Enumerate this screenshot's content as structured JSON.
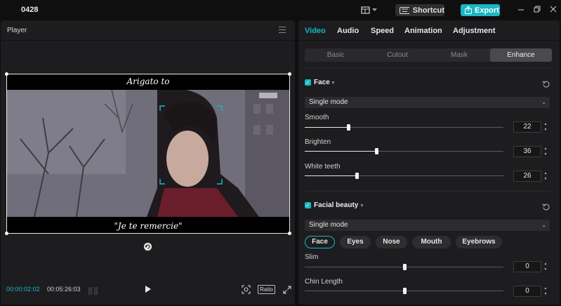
{
  "app": {
    "project_name": "0428",
    "shortcut_label": "Shortcut",
    "export_label": "Export"
  },
  "player": {
    "title": "Player",
    "subtitle_top": "Arigato to",
    "subtitle_bottom": "\"Je te remercie\"",
    "current_time": "00:00:02:02",
    "total_time": "00:05:26:03",
    "ratio_label": "Ratio"
  },
  "panel": {
    "tabs": [
      "Video",
      "Audio",
      "Speed",
      "Animation",
      "Adjustment"
    ],
    "active_tab": "Video",
    "subtabs": [
      "Basic",
      "Cutout",
      "Mask",
      "Enhance"
    ],
    "active_subtab": "Enhance",
    "face": {
      "title": "Face",
      "checked": true,
      "mode": "Single mode",
      "sliders": [
        {
          "label": "Smooth",
          "value": "22",
          "fraction": 0.22
        },
        {
          "label": "Brighten",
          "value": "36",
          "fraction": 0.36
        },
        {
          "label": "White teeth",
          "value": "26",
          "fraction": 0.26
        }
      ]
    },
    "facial_beauty": {
      "title": "Facial beauty",
      "checked": true,
      "mode": "Single mode",
      "pills": [
        "Face",
        "Eyes",
        "Nose",
        "Mouth",
        "Eyebrows"
      ],
      "active_pill": "Face",
      "sliders": [
        {
          "label": "Slim",
          "value": "0",
          "fraction": 0.5
        },
        {
          "label": "Chin Length",
          "value": "0",
          "fraction": 0.5
        }
      ]
    }
  },
  "colors": {
    "accent": "#19b6c4",
    "panel_bg": "#1d1d1f",
    "app_bg": "#0f0f10"
  }
}
